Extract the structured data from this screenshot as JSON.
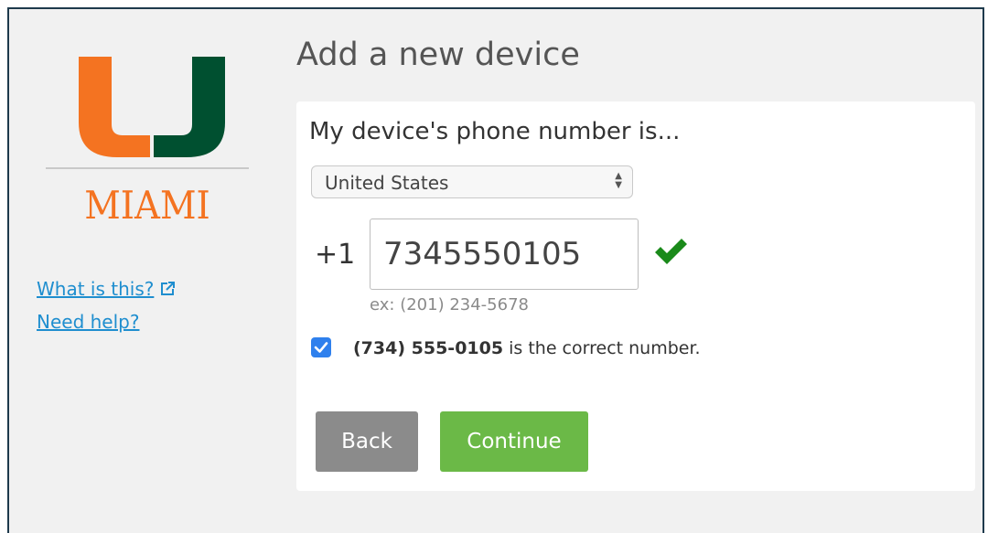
{
  "brand": {
    "wordmark": "MIAMI",
    "colors": {
      "orange": "#f47321",
      "green": "#005030"
    }
  },
  "sidebar": {
    "links": [
      {
        "label": "What is this?",
        "icon": "external-link-icon"
      },
      {
        "label": "Need help?"
      }
    ]
  },
  "page": {
    "title": "Add a new device"
  },
  "form": {
    "heading": "My device's phone number is...",
    "country_select": {
      "value": "United States",
      "icon": "up-down-arrows-icon"
    },
    "country_code": "+1",
    "phone_input": {
      "value": "7345550105",
      "valid_icon": "green-checkmark-icon",
      "valid_color": "#1a8a1a"
    },
    "example": "ex: (201) 234-5678",
    "confirm": {
      "checked": true,
      "number": "(734) 555-0105",
      "text": " is the correct number."
    },
    "buttons": {
      "back": "Back",
      "continue": "Continue",
      "back_color": "#8b8b8b",
      "continue_color": "#6bb947"
    }
  }
}
